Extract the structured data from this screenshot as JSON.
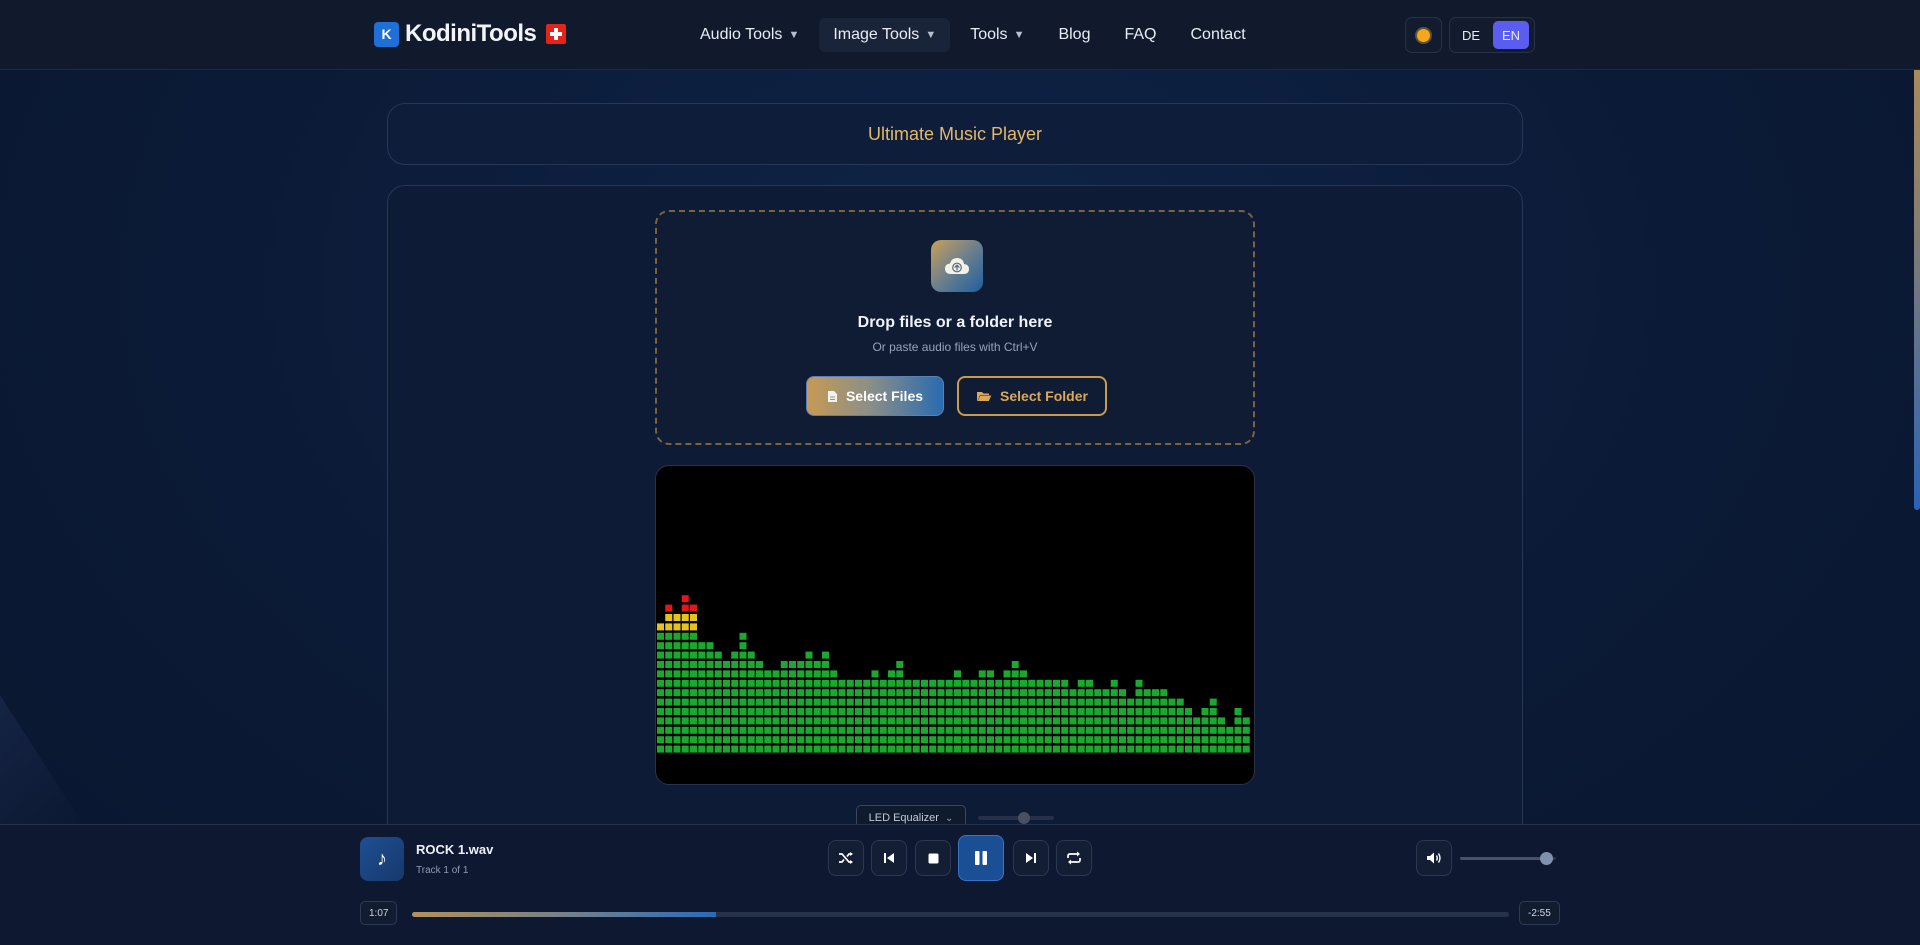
{
  "header": {
    "logo_text": "KodiniTools",
    "nav": [
      {
        "label": "Audio Tools",
        "dropdown": true
      },
      {
        "label": "Image Tools",
        "dropdown": true
      },
      {
        "label": "Tools",
        "dropdown": true
      },
      {
        "label": "Blog",
        "dropdown": false
      },
      {
        "label": "FAQ",
        "dropdown": false
      },
      {
        "label": "Contact",
        "dropdown": false
      }
    ],
    "theme_icon": "sun-icon",
    "languages": [
      "DE",
      "EN"
    ],
    "active_language": "EN"
  },
  "page": {
    "title": "Ultimate Music Player"
  },
  "dropzone": {
    "title": "Drop files or a folder here",
    "subtitle": "Or paste audio files with Ctrl+V",
    "select_files_label": "Select Files",
    "select_folder_label": "Select Folder"
  },
  "visualizer": {
    "mode_label": "LED Equalizer",
    "intensity": 0.6,
    "colors": {
      "low": "#1aa82e",
      "mid": "#e5c21c",
      "peak": "#e0181a"
    },
    "levels": [
      14,
      16,
      15,
      17,
      16,
      12,
      12,
      11,
      10,
      11,
      13,
      11,
      10,
      9,
      9,
      10,
      10,
      10,
      11,
      10,
      11,
      9,
      8,
      8,
      8,
      8,
      9,
      8,
      9,
      10,
      8,
      8,
      8,
      8,
      8,
      8,
      9,
      8,
      8,
      9,
      9,
      8,
      9,
      10,
      9,
      8,
      8,
      8,
      8,
      8,
      7,
      8,
      8,
      7,
      7,
      8,
      7,
      6,
      8,
      7,
      7,
      7,
      6,
      6,
      5,
      4,
      5,
      6,
      4,
      3,
      5,
      4
    ]
  },
  "player": {
    "track_title": "ROCK 1.wav",
    "track_sub": "Track 1 of 1",
    "elapsed": "1:07",
    "remaining": "-2:55",
    "progress": 0.277,
    "volume": 0.9,
    "playing": true
  },
  "colors": {
    "accent_gold": "#d9a85a",
    "accent_blue": "#1b4f95",
    "language_active": "#5b5cf0"
  }
}
